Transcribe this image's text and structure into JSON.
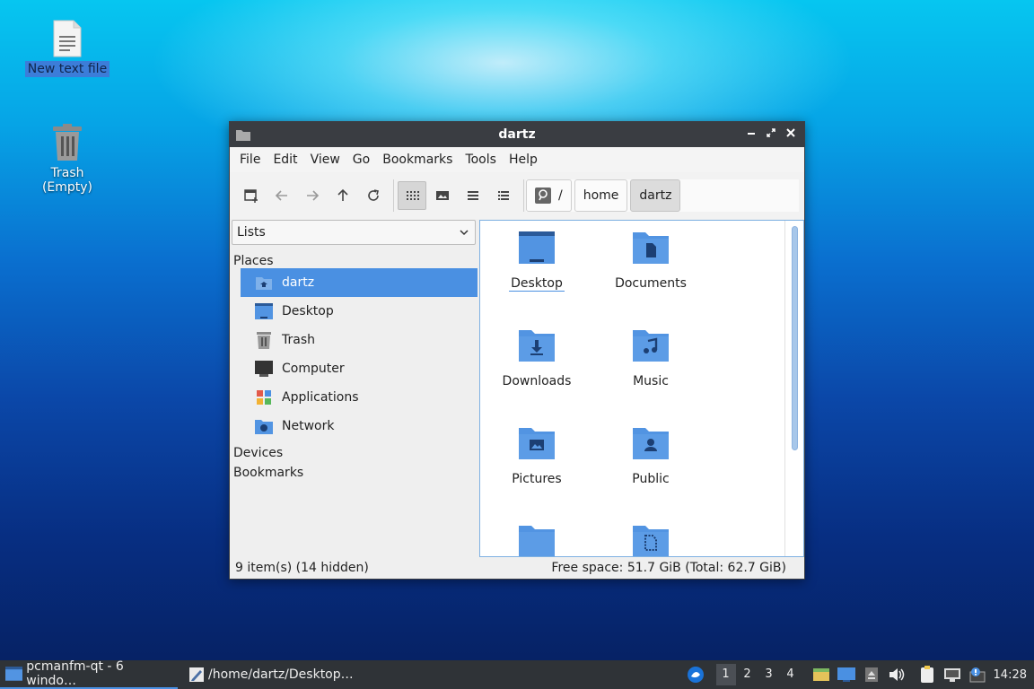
{
  "desktop": {
    "icons": [
      {
        "label": "New text file"
      },
      {
        "label": "Trash (Empty)"
      }
    ]
  },
  "window": {
    "title": "dartz",
    "menu": [
      "File",
      "Edit",
      "View",
      "Go",
      "Bookmarks",
      "Tools",
      "Help"
    ],
    "path": {
      "root": "/",
      "crumbs": [
        "home",
        "dartz"
      ]
    },
    "side_view_select": "Lists",
    "sections": {
      "places": "Places",
      "devices": "Devices",
      "bookmarks": "Bookmarks"
    },
    "places": [
      "dartz",
      "Desktop",
      "Trash",
      "Computer",
      "Applications",
      "Network"
    ],
    "files": [
      "Desktop",
      "Documents",
      "Downloads",
      "Music",
      "Pictures",
      "Public",
      "",
      ""
    ],
    "status_left": "9 item(s) (14 hidden)",
    "status_right": "Free space: 51.7 GiB (Total: 62.7 GiB)"
  },
  "taskbar": {
    "tasks": [
      "pcmanfm-qt - 6 windo…",
      "/home/dartz/Desktop…"
    ],
    "desktops": [
      "1",
      "2",
      "3",
      "4"
    ],
    "clock": "14:28"
  },
  "colors": {
    "accent": "#4a90e2",
    "folder": "#5294e2",
    "titlebar": "#3a3d42",
    "taskbar": "#2f3337"
  }
}
